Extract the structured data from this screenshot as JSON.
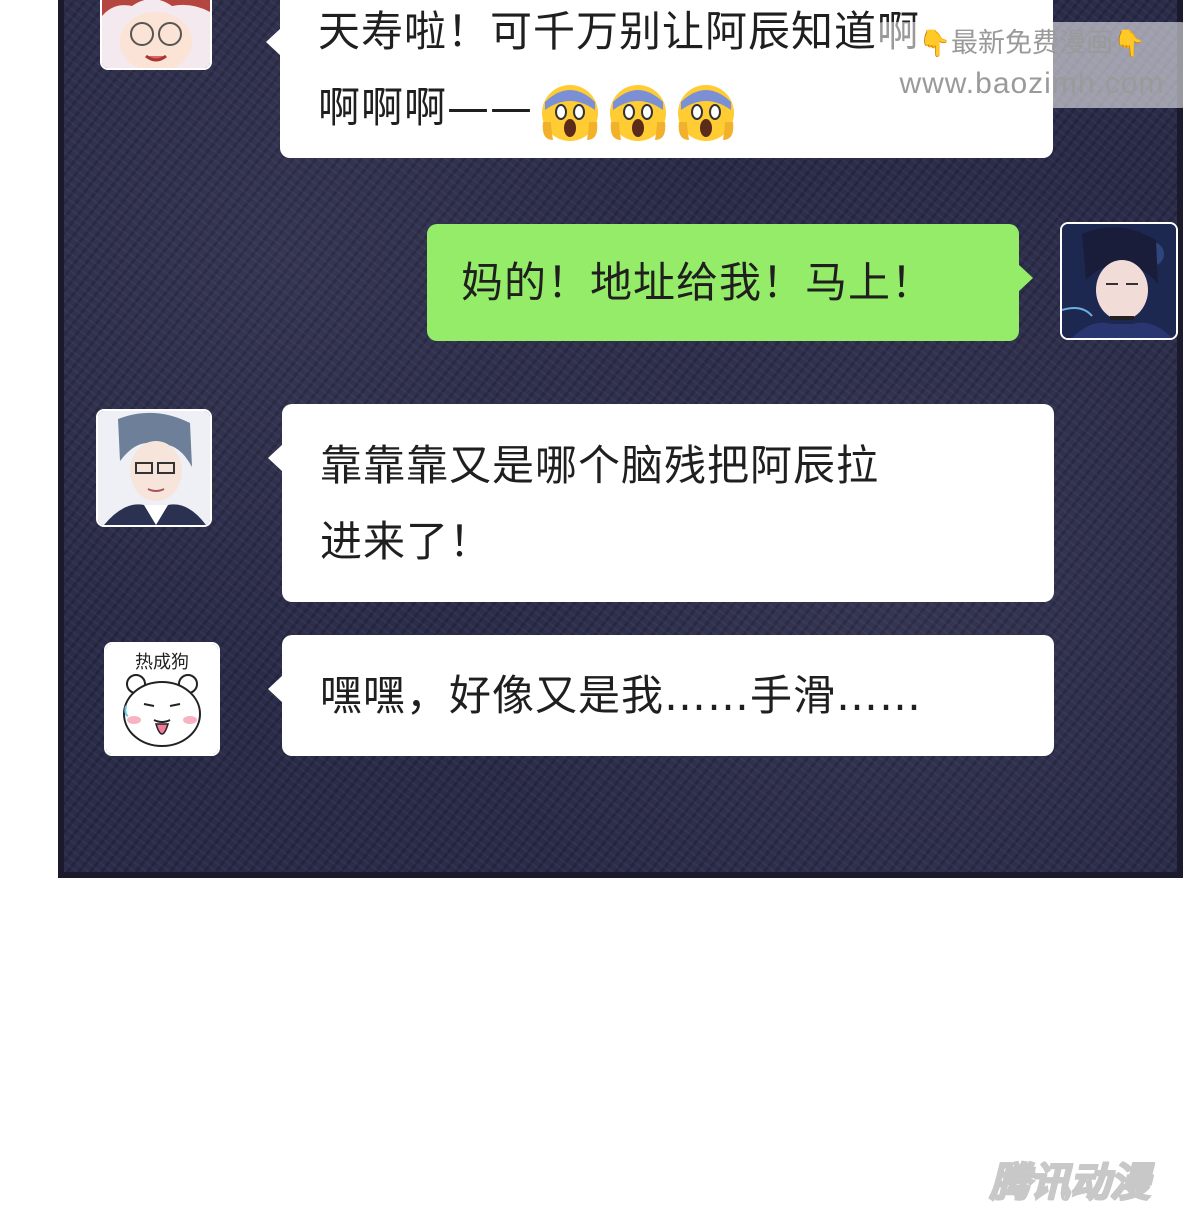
{
  "watermark": {
    "line1": "最新免费漫画",
    "line2": "www.baozimh.com",
    "hand_icon": "pointing-down-hand-icon"
  },
  "messages": [
    {
      "side": "left",
      "sender_avatar": "red-haired-glasses-guy-avatar",
      "lines": [
        "天寿啦！可千万别让阿辰知道啊",
        "啊啊啊——"
      ],
      "emoji": [
        "screaming-face-icon",
        "screaming-face-icon",
        "screaming-face-icon"
      ]
    },
    {
      "side": "right",
      "sender_avatar": "dark-haired-guy-avatar",
      "lines": [
        "妈的！地址给我！马上！"
      ]
    },
    {
      "side": "left",
      "sender_avatar": "grey-haired-glasses-guy-avatar",
      "lines": [
        "靠靠靠又是哪个脑残把阿辰拉",
        "进来了！"
      ]
    },
    {
      "side": "left",
      "sender_avatar": "sticker-dog-avatar",
      "sticker_text": "热成狗",
      "lines": [
        "嘿嘿，好像又是我……手滑……"
      ]
    }
  ],
  "publisher_logo": "腾讯动漫",
  "colors": {
    "panel_bg": "#2b2c4a",
    "bubble_white": "#ffffff",
    "bubble_green": "#95ec69",
    "text": "#1f1f1f"
  }
}
